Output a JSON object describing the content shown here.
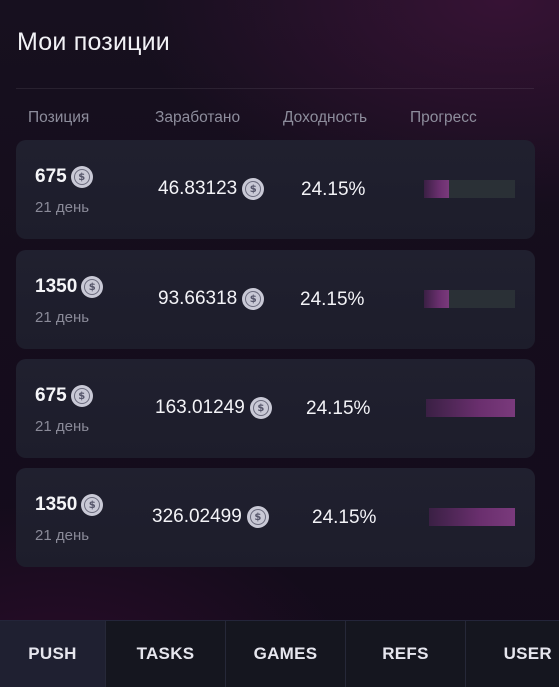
{
  "page": {
    "title": "Мои позиции"
  },
  "table": {
    "headers": {
      "position": "Позиция",
      "earned": "Заработано",
      "yield": "Доходность",
      "progress": "Прогресс"
    },
    "rows": [
      {
        "amount": "675",
        "days": "21 день",
        "earned": "46.83123",
        "yield": "24.15%",
        "progress": 0.27
      },
      {
        "amount": "1350",
        "days": "21 день",
        "earned": "93.66318",
        "yield": "24.15%",
        "progress": 0.27
      },
      {
        "amount": "675",
        "days": "21 день",
        "earned": "163.01249",
        "yield": "24.15%",
        "progress": 1.0
      },
      {
        "amount": "1350",
        "days": "21 день",
        "earned": "326.02499",
        "yield": "24.15%",
        "progress": 1.0
      }
    ]
  },
  "coin_icon": {
    "name": "usd-coin-icon",
    "glyph": "$"
  },
  "nav": {
    "items": [
      {
        "label": "PUSH",
        "active": true
      },
      {
        "label": "TASKS",
        "active": false
      },
      {
        "label": "GAMES",
        "active": false
      },
      {
        "label": "REFS",
        "active": false
      },
      {
        "label": "USER",
        "active": false
      }
    ]
  }
}
